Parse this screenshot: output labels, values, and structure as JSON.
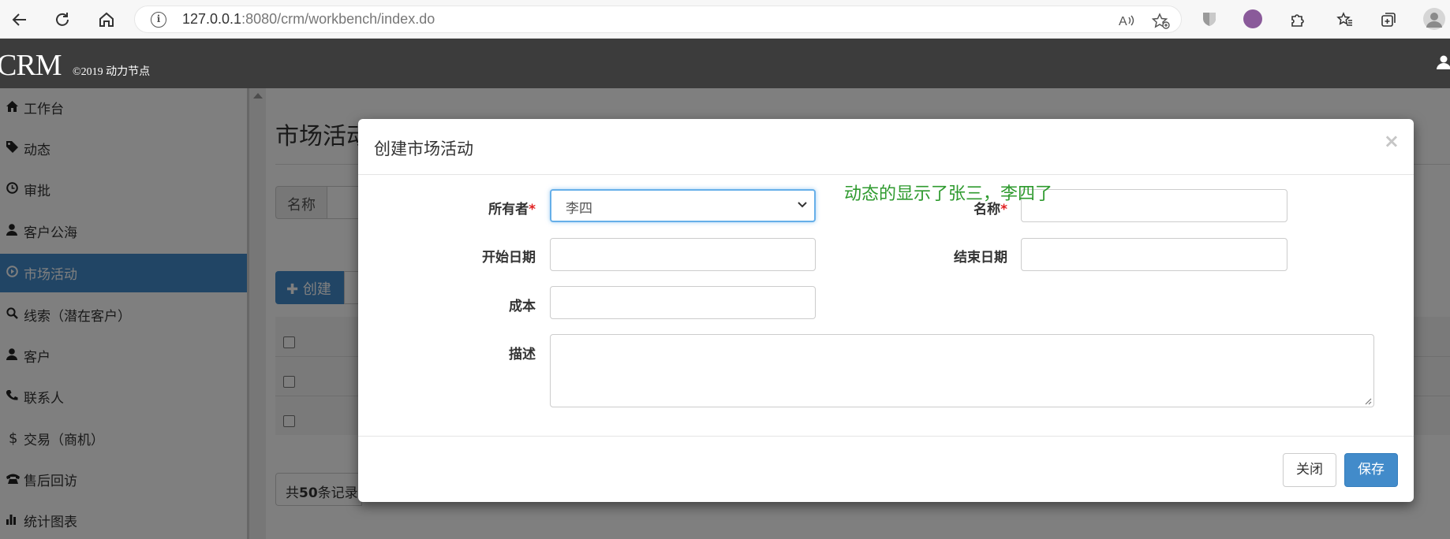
{
  "browser": {
    "url_host": "127.0.0.1",
    "url_rest": ":8080/crm/workbench/index.do"
  },
  "header": {
    "logo": "CRM",
    "copyright": "©2019 动力节点"
  },
  "sidebar": {
    "items": [
      {
        "label": "工作台",
        "icon": "home-icon"
      },
      {
        "label": "动态",
        "icon": "tag-icon"
      },
      {
        "label": "审批",
        "icon": "clock-icon"
      },
      {
        "label": "客户公海",
        "icon": "user-icon"
      },
      {
        "label": "市场活动",
        "icon": "play-circle-icon",
        "active": true
      },
      {
        "label": "线索（潜在客户）",
        "icon": "search-icon"
      },
      {
        "label": "客户",
        "icon": "user-icon"
      },
      {
        "label": "联系人",
        "icon": "phone-icon"
      },
      {
        "label": "交易（商机）",
        "icon": "dollar-icon"
      },
      {
        "label": "售后回访",
        "icon": "phone-alt-icon"
      },
      {
        "label": "统计图表",
        "icon": "stats-icon"
      }
    ]
  },
  "main": {
    "page_title": "市场活动",
    "search_label": "名称",
    "create_label": "创建",
    "total_prefix": "共",
    "total_count": "50",
    "total_suffix": "条记录"
  },
  "modal": {
    "title": "创建市场活动",
    "close_symbol": "×",
    "owner_label": "所有者",
    "owner_value": "李四",
    "name_label": "名称",
    "start_label": "开始日期",
    "end_label": "结束日期",
    "cost_label": "成本",
    "desc_label": "描述",
    "required_mark": "*",
    "note": "动态的显示了张三，李四了",
    "close_button": "关闭",
    "save_button": "保存"
  },
  "colors": {
    "primary": "#428bca",
    "header_bg": "#3c3c3c",
    "note_green": "#2e9a2e",
    "required_red": "#e02020"
  }
}
